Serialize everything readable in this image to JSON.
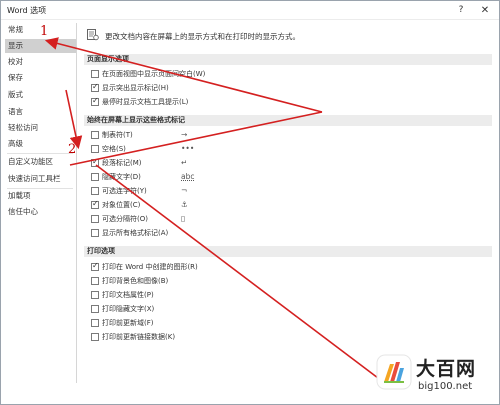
{
  "window": {
    "title": "Word 选项",
    "help_glyph": "?",
    "close_glyph": "✕"
  },
  "sidebar": {
    "items": [
      {
        "label": "常规",
        "selected": false
      },
      {
        "label": "显示",
        "selected": true
      },
      {
        "label": "校对",
        "selected": false
      },
      {
        "label": "保存",
        "selected": false
      },
      {
        "label": "版式",
        "selected": false
      },
      {
        "label": "语言",
        "selected": false
      },
      {
        "label": "轻松访问",
        "selected": false
      },
      {
        "label": "高级",
        "selected": false
      },
      {
        "label": "自定义功能区",
        "selected": false
      },
      {
        "label": "快速访问工具栏",
        "selected": false
      },
      {
        "label": "加载项",
        "selected": false
      },
      {
        "label": "信任中心",
        "selected": false
      }
    ]
  },
  "main": {
    "header": "更改文档内容在屏幕上的显示方式和在打印时的显示方式。",
    "page_display": {
      "title": "页面显示选项",
      "options": [
        {
          "label": "在页面视图中显示页面间空白(W)",
          "checked": false
        },
        {
          "label": "显示突出显示标记(H)",
          "checked": true
        },
        {
          "label": "悬停时显示文档工具提示(L)",
          "checked": true
        }
      ]
    },
    "format_marks": {
      "title": "始终在屏幕上显示这些格式标记",
      "options": [
        {
          "label": "制表符(T)",
          "checked": false,
          "mark": "→"
        },
        {
          "label": "空格(S)",
          "checked": false,
          "mark": "•••"
        },
        {
          "label": "段落标记(M)",
          "checked": true,
          "mark": "↵"
        },
        {
          "label": "隐藏文字(D)",
          "checked": false,
          "mark": "abc"
        },
        {
          "label": "可选连字符(Y)",
          "checked": false,
          "mark": "¬"
        },
        {
          "label": "对象位置(C)",
          "checked": true,
          "mark": "⚓"
        },
        {
          "label": "可选分隔符(O)",
          "checked": false,
          "mark": "▯"
        },
        {
          "label": "显示所有格式标记(A)",
          "checked": false,
          "mark": ""
        }
      ]
    },
    "print": {
      "title": "打印选项",
      "options": [
        {
          "label": "打印在 Word 中创建的图形(R)",
          "checked": true
        },
        {
          "label": "打印背景色和图像(B)",
          "checked": false
        },
        {
          "label": "打印文档属性(P)",
          "checked": false
        },
        {
          "label": "打印隐藏文字(X)",
          "checked": false
        },
        {
          "label": "打印前更新域(F)",
          "checked": false
        },
        {
          "label": "打印前更新链接数据(K)",
          "checked": false
        }
      ]
    }
  },
  "annotations": {
    "step1": "1",
    "step2": "2",
    "arrow_color": "#d42020"
  },
  "watermark": {
    "name": "大百网",
    "url": "big100.net"
  }
}
